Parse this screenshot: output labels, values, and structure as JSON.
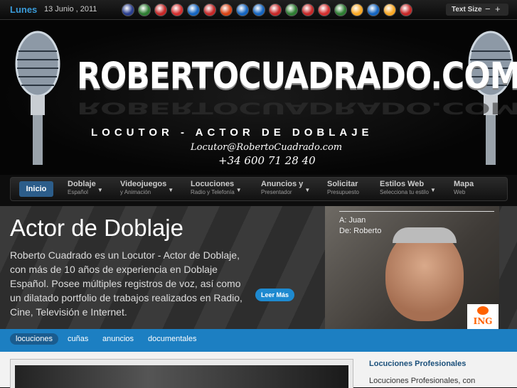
{
  "topbar": {
    "day": "Lunes",
    "date": "13 Junio , 2011",
    "flags": [
      {
        "name": "english-flag-icon",
        "color": "#2b3f8f"
      },
      {
        "name": "arabic-flag-icon",
        "color": "#2e7d32"
      },
      {
        "name": "belarus-flag-icon",
        "color": "#c62828"
      },
      {
        "name": "catalan-flag-icon",
        "color": "#d32f2f"
      },
      {
        "name": "czech-flag-icon",
        "color": "#1565c0"
      },
      {
        "name": "danish-flag-icon",
        "color": "#c62828"
      },
      {
        "name": "dutch-flag-icon",
        "color": "#d84315"
      },
      {
        "name": "finnish-flag-icon",
        "color": "#1565c0"
      },
      {
        "name": "french-flag-icon",
        "color": "#1565c0"
      },
      {
        "name": "german-flag-icon",
        "color": "#c62828"
      },
      {
        "name": "italian-flag-icon",
        "color": "#2e7d32"
      },
      {
        "name": "norwegian-flag-icon",
        "color": "#c62828"
      },
      {
        "name": "polish-flag-icon",
        "color": "#d32f2f"
      },
      {
        "name": "portuguese-flag-icon",
        "color": "#2e7d32"
      },
      {
        "name": "romanian-flag-icon",
        "color": "#f9a825"
      },
      {
        "name": "russian-flag-icon",
        "color": "#1565c0"
      },
      {
        "name": "spanish-flag-icon",
        "color": "#f9a825"
      },
      {
        "name": "serbian-flag-icon",
        "color": "#c62828"
      }
    ],
    "text_size_label": "Text Size",
    "minus": "−",
    "plus": "+"
  },
  "header": {
    "site_title": "ROBERTOCUADRADO.COM",
    "tagline": "LOCUTOR - ACTOR DE DOBLAJE",
    "email": "Locutor@RobertoCuadrado.com",
    "phone": "+34 600 71 28 40"
  },
  "nav": {
    "home": "Inicio",
    "items": [
      {
        "title": "Doblaje",
        "sub": "Español"
      },
      {
        "title": "Videojuegos",
        "sub": "y Animación"
      },
      {
        "title": "Locuciones",
        "sub": "Radio y Telefonía"
      },
      {
        "title": "Anuncios y",
        "sub": "Presentador"
      },
      {
        "title": "Solicitar",
        "sub": "Presupuesto"
      },
      {
        "title": "Estilos Web",
        "sub": "Selecciona tu estilo"
      },
      {
        "title": "Mapa",
        "sub": "Web"
      }
    ]
  },
  "hero": {
    "title": "Actor de Doblaje",
    "text": "Roberto Cuadrado es un Locutor - Actor de Doblaje, con más de 10 años de experiencia en Doblaje Español. Posee múltiples registros de voz, así como un dilatado portfolio de trabajos realizados en Radio, Cine, Televisión e Internet.",
    "read_more": "Leer Más",
    "photo_to": "A: Juan",
    "photo_from": "De: Roberto",
    "ing_logo": "ING"
  },
  "tabs": [
    "locuciones",
    "cuñas",
    "anuncios",
    "documentales"
  ],
  "content": {
    "side_title": "Locuciones Profesionales",
    "side_text": "Locuciones Profesionales, con"
  }
}
